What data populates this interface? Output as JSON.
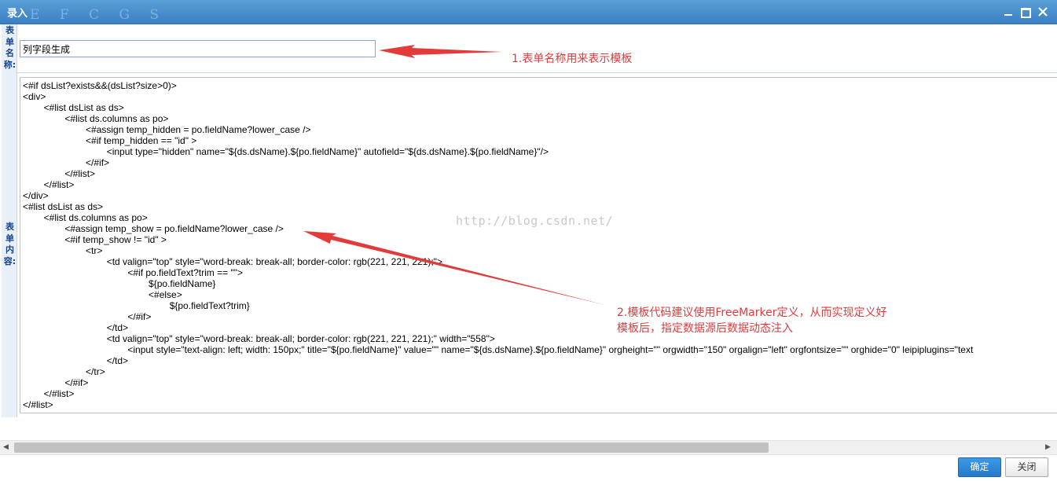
{
  "window": {
    "title": "录入",
    "watermark": "E F C G S"
  },
  "labels": {
    "name_label": "表单名称:",
    "content_label": "表单内容:"
  },
  "form": {
    "name_value": "列字段生成"
  },
  "code": {
    "lines": [
      "<#if dsList?exists&&(dsList?size>0)>",
      "<div>",
      "        <#list dsList as ds>",
      "                <#list ds.columns as po>",
      "                        <#assign temp_hidden = po.fieldName?lower_case />",
      "                        <#if temp_hidden == \"id\" >",
      "                                <input type=\"hidden\" name=\"${ds.dsName}.${po.fieldName}\" autofield=\"${ds.dsName}.${po.fieldName}\"/>",
      "                        </#if>",
      "                </#list>",
      "        </#list>",
      "</div>",
      "<#list dsList as ds>",
      "        <#list ds.columns as po>",
      "                <#assign temp_show = po.fieldName?lower_case />",
      "                <#if temp_show != \"id\" >",
      "                        <tr>",
      "                                <td valign=\"top\" style=\"word-break: break-all; border-color: rgb(221, 221, 221);\">",
      "                                        <#if po.fieldText?trim == \"\">",
      "                                                ${po.fieldName}",
      "                                                <#else>",
      "                                                        ${po.fieldText?trim}",
      "                                        </#if>",
      "                                </td>",
      "                                <td valign=\"top\" style=\"word-break: break-all; border-color: rgb(221, 221, 221);\" width=\"558\">",
      "                                        <input style=\"text-align: left; width: 150px;\" title=\"${po.fieldName}\" value=\"\" name=\"${ds.dsName}.${po.fieldName}\" orgheight=\"\" orgwidth=\"150\" orgalign=\"left\" orgfontsize=\"\" orghide=\"0\" leipiplugins=\"text",
      "                                </td>",
      "                        </tr>",
      "                </#if>",
      "        </#list>",
      "</#list>"
    ]
  },
  "watermark_text": "http://blog.csdn.net/",
  "annotations": {
    "a1": "1.表单名称用来表示模板",
    "a2_line1": "2.模板代码建议使用FreeMarker定义，从而实现定义好",
    "a2_line2": "模板后，指定数据源后数据动态注入"
  },
  "footer": {
    "ok_label": "确定",
    "cancel_label": "关闭"
  },
  "colors": {
    "titlebar": "#4a8fd0",
    "annotation": "#e33a3a",
    "ok_button": "#2f86d6"
  }
}
